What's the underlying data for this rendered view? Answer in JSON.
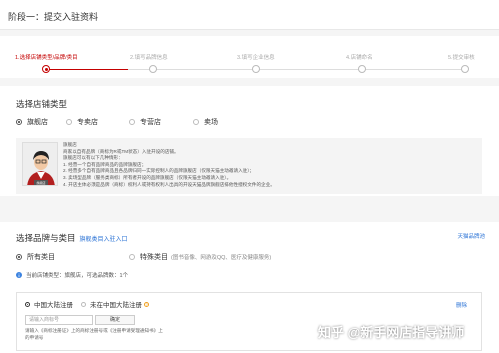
{
  "page": {
    "title": "阶段一：提交入驻资料"
  },
  "progress": {
    "steps": [
      {
        "label": "1.选择店铺类型/品牌/类目"
      },
      {
        "label": "2.填写品牌信息"
      },
      {
        "label": "3.填写企业信息"
      },
      {
        "label": "4.店铺命名"
      },
      {
        "label": "5.提交审核"
      }
    ],
    "active_index": 0,
    "accent_color": "#c40000"
  },
  "store_type": {
    "title": "选择店铺类型",
    "options": [
      {
        "label": "旗舰店",
        "checked": true
      },
      {
        "label": "专卖店",
        "checked": false
      },
      {
        "label": "专营店",
        "checked": false
      },
      {
        "label": "卖场",
        "checked": false
      }
    ],
    "info": {
      "avatar_caption": "旗舰店",
      "lines": [
        "旗舰店",
        "商家以自有品牌（商标为R或TM状态）入驻开设的店铺。",
        "旗舰店可以有以下几种情形：",
        "1. 经营一个自有品牌商品的品牌旗舰店；",
        "2. 经营多个自有品牌商品且各品牌归同一实际控制人的品牌旗舰店（仅限天猫主动邀请入驻）；",
        "3. 卖场型品牌（服务类商标）所有者开设的品牌旗舰店（仅限天猫主动邀请入驻）。",
        "4. 开店主体必须是品牌（商标）权利人或持有权利人出具的开设天猫品牌旗舰店排他性授权文件的企业。"
      ]
    }
  },
  "brand_section": {
    "title": "选择品牌与类目",
    "link": "旗舰类目入驻入口",
    "right_link": "天猫品牌池",
    "categories": [
      {
        "label": "所有类目",
        "checked": true,
        "desc": ""
      },
      {
        "label": "特殊类目",
        "checked": false,
        "desc": "(图书音像、网游及QQ、医疗及健康服务)"
      }
    ],
    "tip": "当前店铺类型：旗舰店，可选品牌数：1个",
    "register": {
      "options": [
        {
          "label": "中国大陆注册",
          "checked": true
        },
        {
          "label": "未在中国大陆注册",
          "checked": false
        }
      ],
      "delete_label": "删除",
      "input_placeholder": "请输入商标号",
      "confirm_label": "确定",
      "note": "请输入《商标注册证》上的商标注册号或《注册申请受理通知书》上的申请号"
    }
  },
  "watermark": "知乎 @新手网店指导讲师"
}
